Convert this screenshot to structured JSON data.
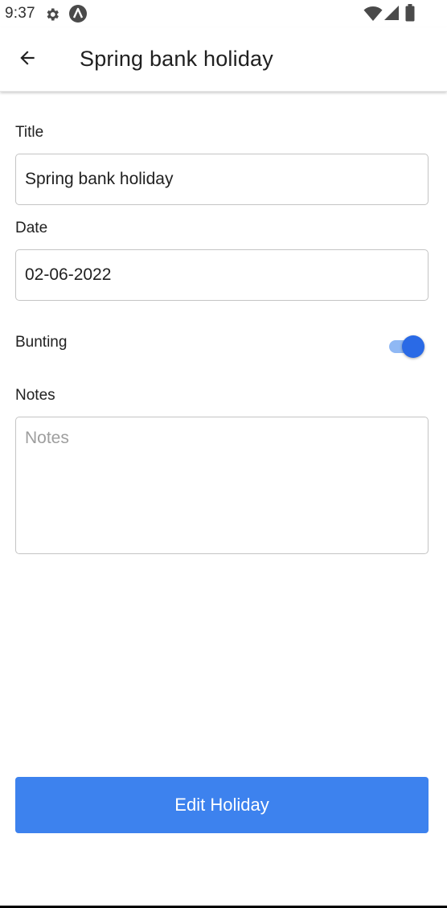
{
  "status_bar": {
    "time": "9:37",
    "icons": [
      "gear-icon",
      "a-icon",
      "wifi-icon",
      "signal-icon",
      "battery-icon"
    ]
  },
  "app_bar": {
    "back_icon": "arrow-left-icon",
    "title": "Spring bank holiday"
  },
  "form": {
    "title_label": "Title",
    "title_value": "Spring bank holiday",
    "date_label": "Date",
    "date_value": "02-06-2022",
    "bunting_label": "Bunting",
    "bunting_on": true,
    "notes_label": "Notes",
    "notes_placeholder": "Notes",
    "notes_value": ""
  },
  "actions": {
    "edit_label": "Edit Holiday"
  },
  "colors": {
    "accent": "#3d82ee",
    "toggle_thumb": "#2a6ae6",
    "toggle_track": "#8fb8f4"
  }
}
